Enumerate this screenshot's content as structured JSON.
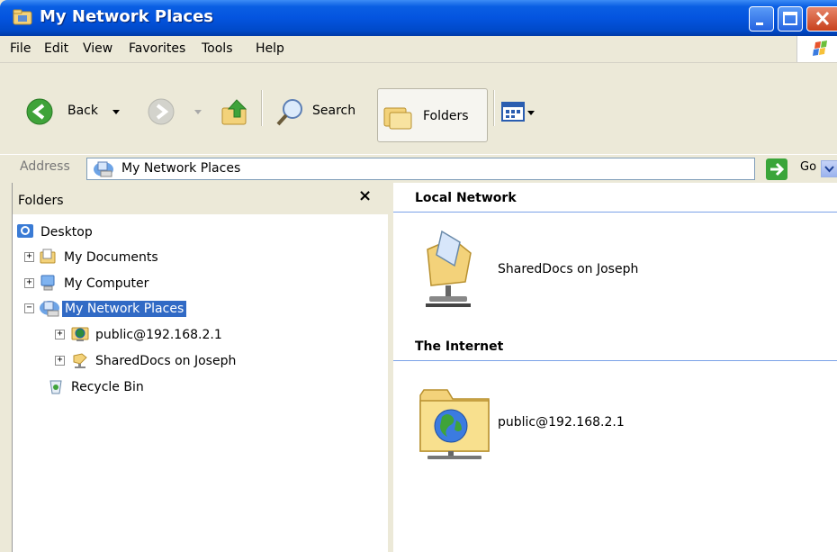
{
  "window": {
    "title": "My Network Places",
    "controls": {
      "minimize": "minimize",
      "maximize": "maximize",
      "close": "close"
    }
  },
  "menu": {
    "items": [
      "File",
      "Edit",
      "View",
      "Favorites",
      "Tools",
      "Help"
    ]
  },
  "toolbar": {
    "back_label": "Back",
    "search_label": "Search",
    "folders_label": "Folders"
  },
  "address": {
    "label": "Address",
    "value": "My Network Places",
    "go_label": "Go"
  },
  "folders_pane": {
    "title": "Folders",
    "close_glyph": "×",
    "tree": [
      {
        "label": "Desktop",
        "icon": "desktop-icon"
      },
      {
        "label": "My Documents",
        "icon": "my-documents-icon",
        "expander": "+"
      },
      {
        "label": "My Computer",
        "icon": "my-computer-icon",
        "expander": "+"
      },
      {
        "label": "My Network Places",
        "icon": "network-places-icon",
        "expander": "−",
        "selected": true
      },
      {
        "label": "public@192.168.2.1",
        "icon": "network-folder-internet-icon",
        "expander": "+"
      },
      {
        "label": "SharedDocs on Joseph",
        "icon": "network-share-icon",
        "expander": "+"
      },
      {
        "label": "Recycle Bin",
        "icon": "recycle-bin-icon"
      }
    ]
  },
  "content": {
    "groups": [
      {
        "title": "Local Network",
        "items": [
          {
            "label": "SharedDocs on Joseph",
            "icon": "network-share-folder-icon"
          }
        ]
      },
      {
        "title": "The Internet",
        "items": [
          {
            "label": "public@192.168.2.1",
            "icon": "internet-folder-icon"
          }
        ]
      }
    ]
  },
  "colors": {
    "titlebar": "#0454DF",
    "selection": "#316AC5",
    "chrome": "#ECE9D8"
  }
}
